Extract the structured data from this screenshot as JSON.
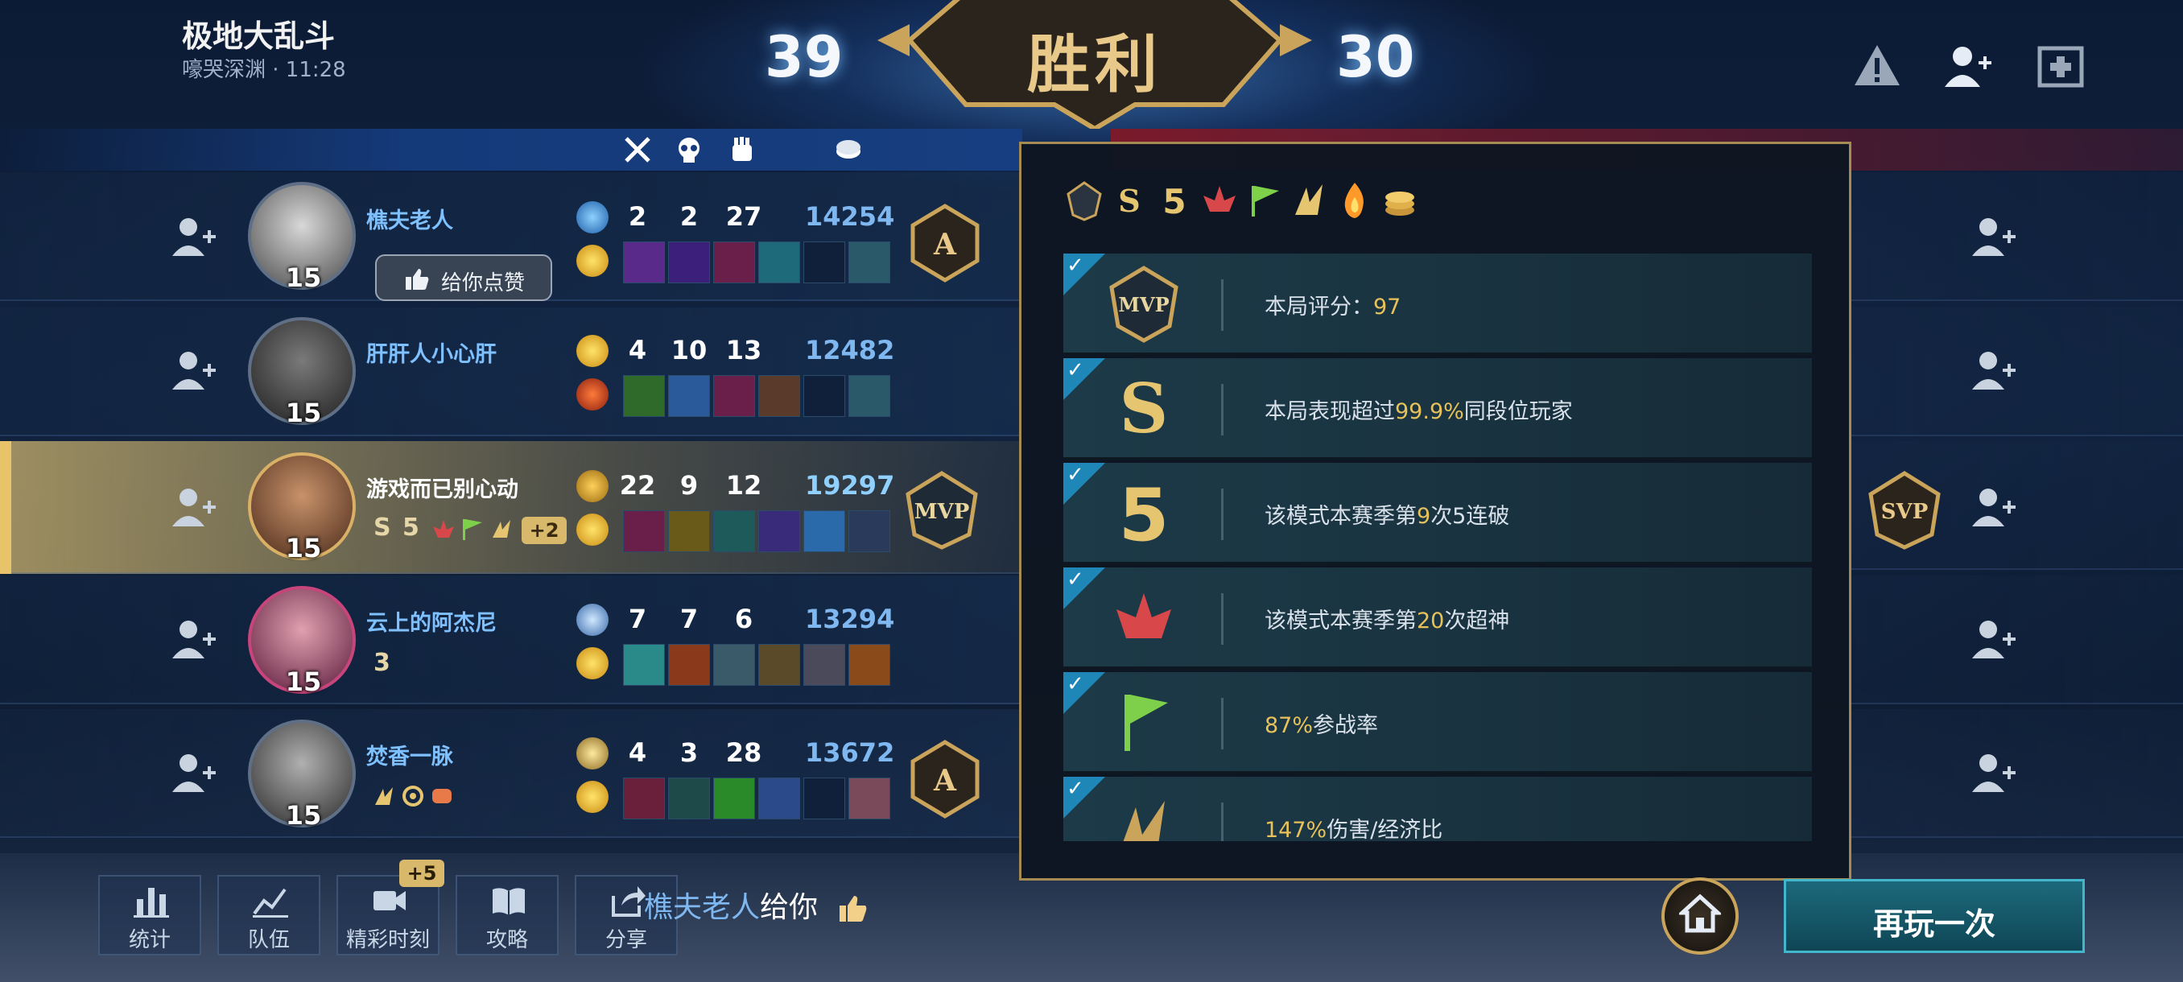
{
  "header": {
    "mode_title": "极地大乱斗",
    "mode_sub": "嚎哭深渊 · 11:28",
    "score_left": "39",
    "score_right": "30",
    "result": "胜利"
  },
  "column_icons": [
    "kills-icon",
    "deaths-icon",
    "assists-icon",
    "gold-icon"
  ],
  "players": [
    {
      "name": "樵夫老人",
      "level": "15",
      "kills": "2",
      "deaths": "2",
      "assists": "27",
      "gold": "14254",
      "badge": "A"
    },
    {
      "name": "肝肝人小心肝",
      "level": "15",
      "kills": "4",
      "deaths": "10",
      "assists": "13",
      "gold": "12482",
      "badge": ""
    },
    {
      "name": "游戏而已别心动",
      "level": "15",
      "kills": "22",
      "deaths": "9",
      "assists": "12",
      "gold": "19297",
      "badge": "MVP",
      "extra_badges": "+2"
    },
    {
      "name": "云上的阿杰尼",
      "level": "15",
      "kills": "7",
      "deaths": "7",
      "assists": "6",
      "gold": "13294",
      "badge": ""
    },
    {
      "name": "焚香一脉",
      "level": "15",
      "kills": "4",
      "deaths": "3",
      "assists": "28",
      "gold": "13672",
      "badge": "A"
    }
  ],
  "like_tooltip": "给你点赞",
  "enemy_badge": "SVP",
  "popup": {
    "achievements": [
      {
        "icon": "MVP",
        "text_pre": "本局评分：",
        "value": "97",
        "text_post": ""
      },
      {
        "icon": "S",
        "text_pre": "本局表现超过",
        "value": "99.9%",
        "text_post": "同段位玩家"
      },
      {
        "icon": "5",
        "text_pre": "该模式本赛季第",
        "value": "9",
        "text_post": "次5连破"
      },
      {
        "icon": "legendary",
        "text_pre": "该模式本赛季第",
        "value": "20",
        "text_post": "次超神"
      },
      {
        "icon": "flag",
        "text_pre": "",
        "value": "87%",
        "text_post": "参战率"
      },
      {
        "icon": "damage",
        "text_pre": "",
        "value": "147%",
        "text_post": "伤害/经济比"
      }
    ]
  },
  "bottom": {
    "stats": "统计",
    "team": "队伍",
    "highlights": "精彩时刻",
    "highlights_badge": "+5",
    "guide": "攻略",
    "share": "分享",
    "ticker_who": "樵夫老人",
    "ticker_rest": "给你",
    "replay": "再玩一次"
  },
  "colors": {
    "accent_gold": "#e7c15a",
    "name_blue": "#7fc0ff",
    "replay": "#1c6a7c"
  }
}
